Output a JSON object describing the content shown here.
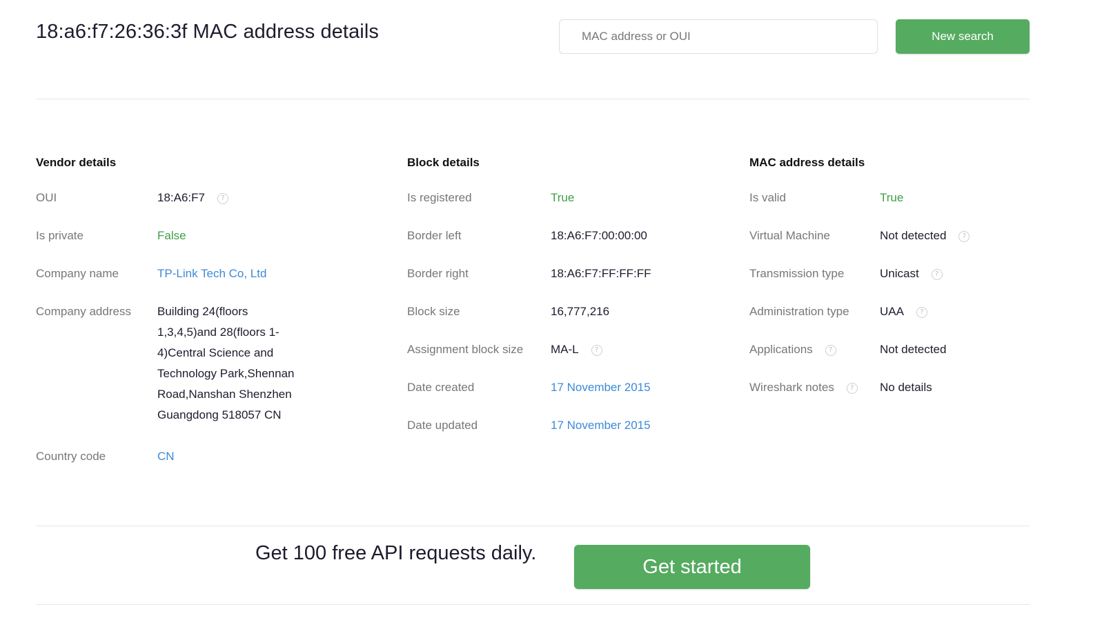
{
  "header": {
    "title": "18:a6:f7:26:36:3f MAC address details",
    "search_placeholder": "MAC address or OUI",
    "search_value": "",
    "new_search_label": "New search"
  },
  "vendor": {
    "heading": "Vendor details",
    "oui_label": "OUI",
    "oui_value": "18:A6:F7",
    "private_label": "Is private",
    "private_value": "False",
    "company_label": "Company name",
    "company_value": "TP-Link Tech Co, Ltd",
    "address_label": "Company address",
    "address_value": "Building 24(floors 1,3,4,5)and 28(floors 1-4)Central Science and Technology Park,Shennan Road,Nanshan Shenzhen Guangdong 518057 CN",
    "country_label": "Country code",
    "country_value": "CN"
  },
  "block": {
    "heading": "Block details",
    "registered_label": "Is registered",
    "registered_value": "True",
    "left_label": "Border left",
    "left_value": "18:A6:F7:00:00:00",
    "right_label": "Border right",
    "right_value": "18:A6:F7:FF:FF:FF",
    "size_label": "Block size",
    "size_value": "16,777,216",
    "assign_label": "Assignment block size",
    "assign_value": "MA-L",
    "created_label": "Date created",
    "created_value": "17 November 2015",
    "updated_label": "Date updated",
    "updated_value": "17 November 2015"
  },
  "mac": {
    "heading": "MAC address details",
    "valid_label": "Is valid",
    "valid_value": "True",
    "vm_label": "Virtual Machine",
    "vm_value": "Not detected",
    "tx_label": "Transmission type",
    "tx_value": "Unicast",
    "admin_label": "Administration type",
    "admin_value": "UAA",
    "apps_label": "Applications",
    "apps_value": "Not detected",
    "wireshark_label": "Wireshark notes",
    "wireshark_value": "No details"
  },
  "cta": {
    "text": "Get 100 free API requests daily.",
    "button_label": "Get started"
  },
  "icons": {
    "help": "?"
  },
  "colors": {
    "accent_green": "#55ab5f",
    "value_green": "#3f9e47",
    "link_blue": "#3c8ad8",
    "label_gray": "#777777"
  }
}
